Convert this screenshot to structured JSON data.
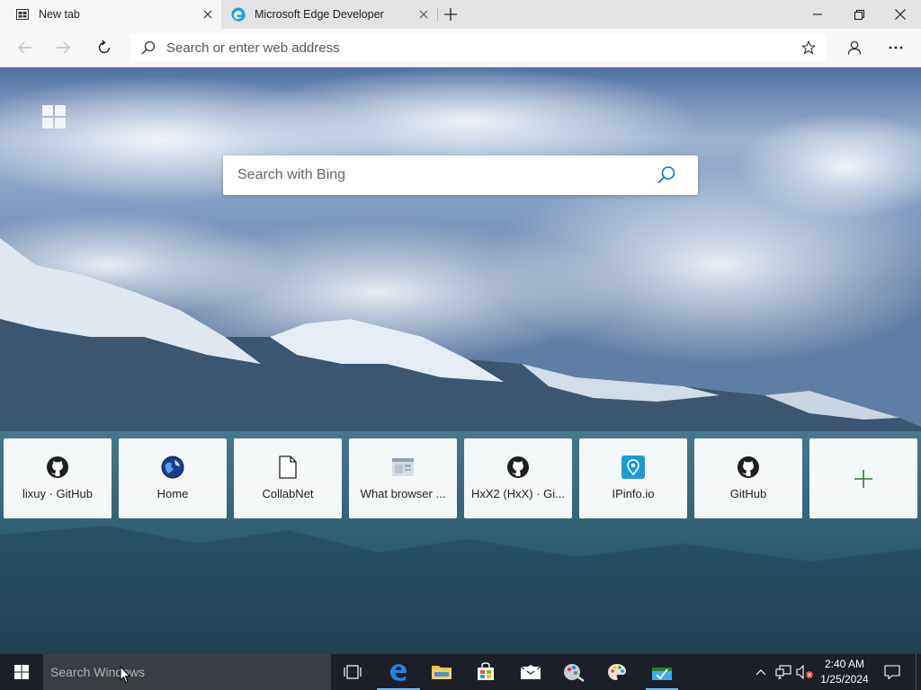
{
  "browser": {
    "tabs": [
      {
        "title": "New tab",
        "icon": "newtab-page-icon",
        "active": true
      },
      {
        "title": "Microsoft Edge Developer",
        "icon": "edge-logo-icon",
        "active": false
      }
    ],
    "address_bar": {
      "placeholder": "Search or enter web address",
      "value": ""
    }
  },
  "newtab": {
    "search_placeholder": "Search with Bing",
    "quick_links": [
      {
        "label": "lixuy · GitHub",
        "icon": "github-icon"
      },
      {
        "label": "Home",
        "icon": "globe-icon"
      },
      {
        "label": "CollabNet",
        "icon": "document-icon"
      },
      {
        "label": "What browser ...",
        "icon": "website-thumbnail-icon"
      },
      {
        "label": "HxX2 (HxX) · Gi...",
        "icon": "github-icon"
      },
      {
        "label": "IPinfo.io",
        "icon": "ipinfo-icon"
      },
      {
        "label": "GitHub",
        "icon": "github-icon"
      }
    ],
    "add_tile_icon": "plus-icon"
  },
  "taskbar": {
    "search_placeholder": "Search Windows",
    "pinned": [
      "task-view-icon",
      "edge-icon",
      "file-explorer-icon",
      "store-icon",
      "mail-icon",
      "app-icon",
      "paint-icon",
      "app-icon"
    ],
    "time": "2:40 AM",
    "date": "1/25/2024"
  },
  "colors": {
    "tab_bar": "#e3e3e3",
    "active_tab": "#f7f7f7",
    "taskbar": "#1d1f28",
    "accent": "#0078d4",
    "plus_green": "#2e7d32"
  }
}
